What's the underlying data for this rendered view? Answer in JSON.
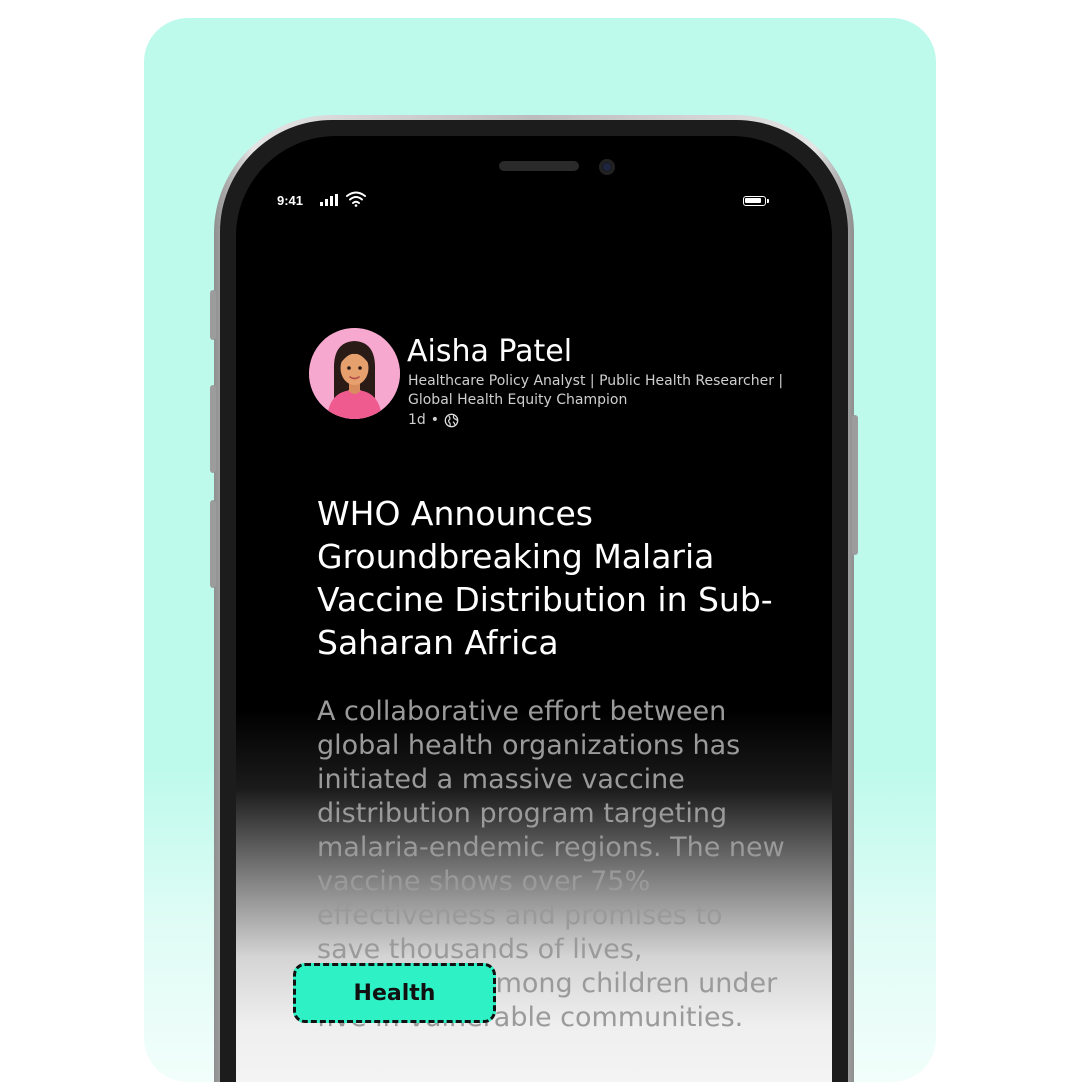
{
  "status_bar": {
    "time": "9:41"
  },
  "post": {
    "author_name": "Aisha Patel",
    "author_headline": "Healthcare Policy Analyst | Public Health Researcher | Global Health Equity Champion",
    "age": "1d",
    "separator": "•",
    "visibility_icon": "globe-icon",
    "title": "WHO Announces Groundbreaking Malaria Vaccine Distribution in Sub-Saharan Africa",
    "body": "A collaborative effort between global health organizations has initiated a massive vaccine distribution program targeting malaria-endemic regions. The new vaccine shows over 75% effectiveness and promises to save thousands of lives, particularly among children under five in vulnerable communities."
  },
  "tag": {
    "label": "Health"
  },
  "colors": {
    "background": "#bdfaec",
    "tag": "#2ff1c6",
    "avatar": "#f7a8cf"
  }
}
